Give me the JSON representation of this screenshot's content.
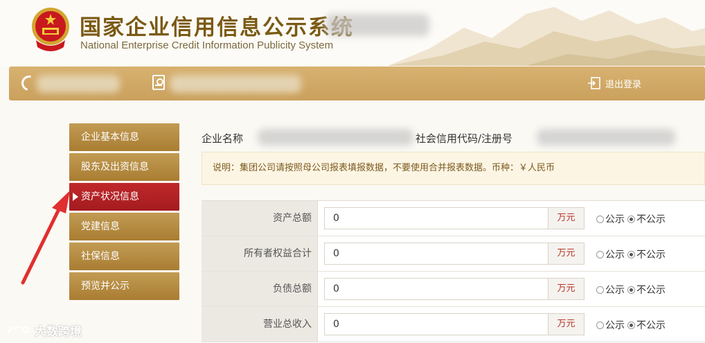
{
  "header": {
    "title_cn": "国家企业信用信息公示系统",
    "title_en": "National Enterprise Credit Information Publicity System"
  },
  "topbar": {
    "logout_label": "退出登录"
  },
  "sidebar": {
    "items": [
      {
        "label": "企业基本信息",
        "active": false
      },
      {
        "label": "股东及出资信息",
        "active": false
      },
      {
        "label": "资产状况信息",
        "active": true
      },
      {
        "label": "党建信息",
        "active": false
      },
      {
        "label": "社保信息",
        "active": false
      },
      {
        "label": "预览并公示",
        "active": false
      }
    ]
  },
  "main": {
    "company_name_label": "企业名称",
    "credit_code_label": "社会信用代码/注册号",
    "notice": "说明：集团公司请按照母公司报表填报数据，不要使用合并报表数据。币种：￥人民币",
    "rows": [
      {
        "label": "资产总额",
        "value": "0",
        "unit": "万元",
        "opt_public": "公示",
        "opt_private": "不公示",
        "selected": "不公示"
      },
      {
        "label": "所有者权益合计",
        "value": "0",
        "unit": "万元",
        "opt_public": "公示",
        "opt_private": "不公示",
        "selected": "不公示"
      },
      {
        "label": "负债总额",
        "value": "0",
        "unit": "万元",
        "opt_public": "公示",
        "opt_private": "不公示",
        "selected": "不公示"
      },
      {
        "label": "营业总收入",
        "value": "0",
        "unit": "万元",
        "opt_public": "公示",
        "opt_private": "不公示",
        "selected": "不公示"
      }
    ]
  },
  "watermark": "大数跨境",
  "colors": {
    "gold": "#c9a05b",
    "active_red": "#b32126",
    "title_brown": "#7a5a14"
  }
}
